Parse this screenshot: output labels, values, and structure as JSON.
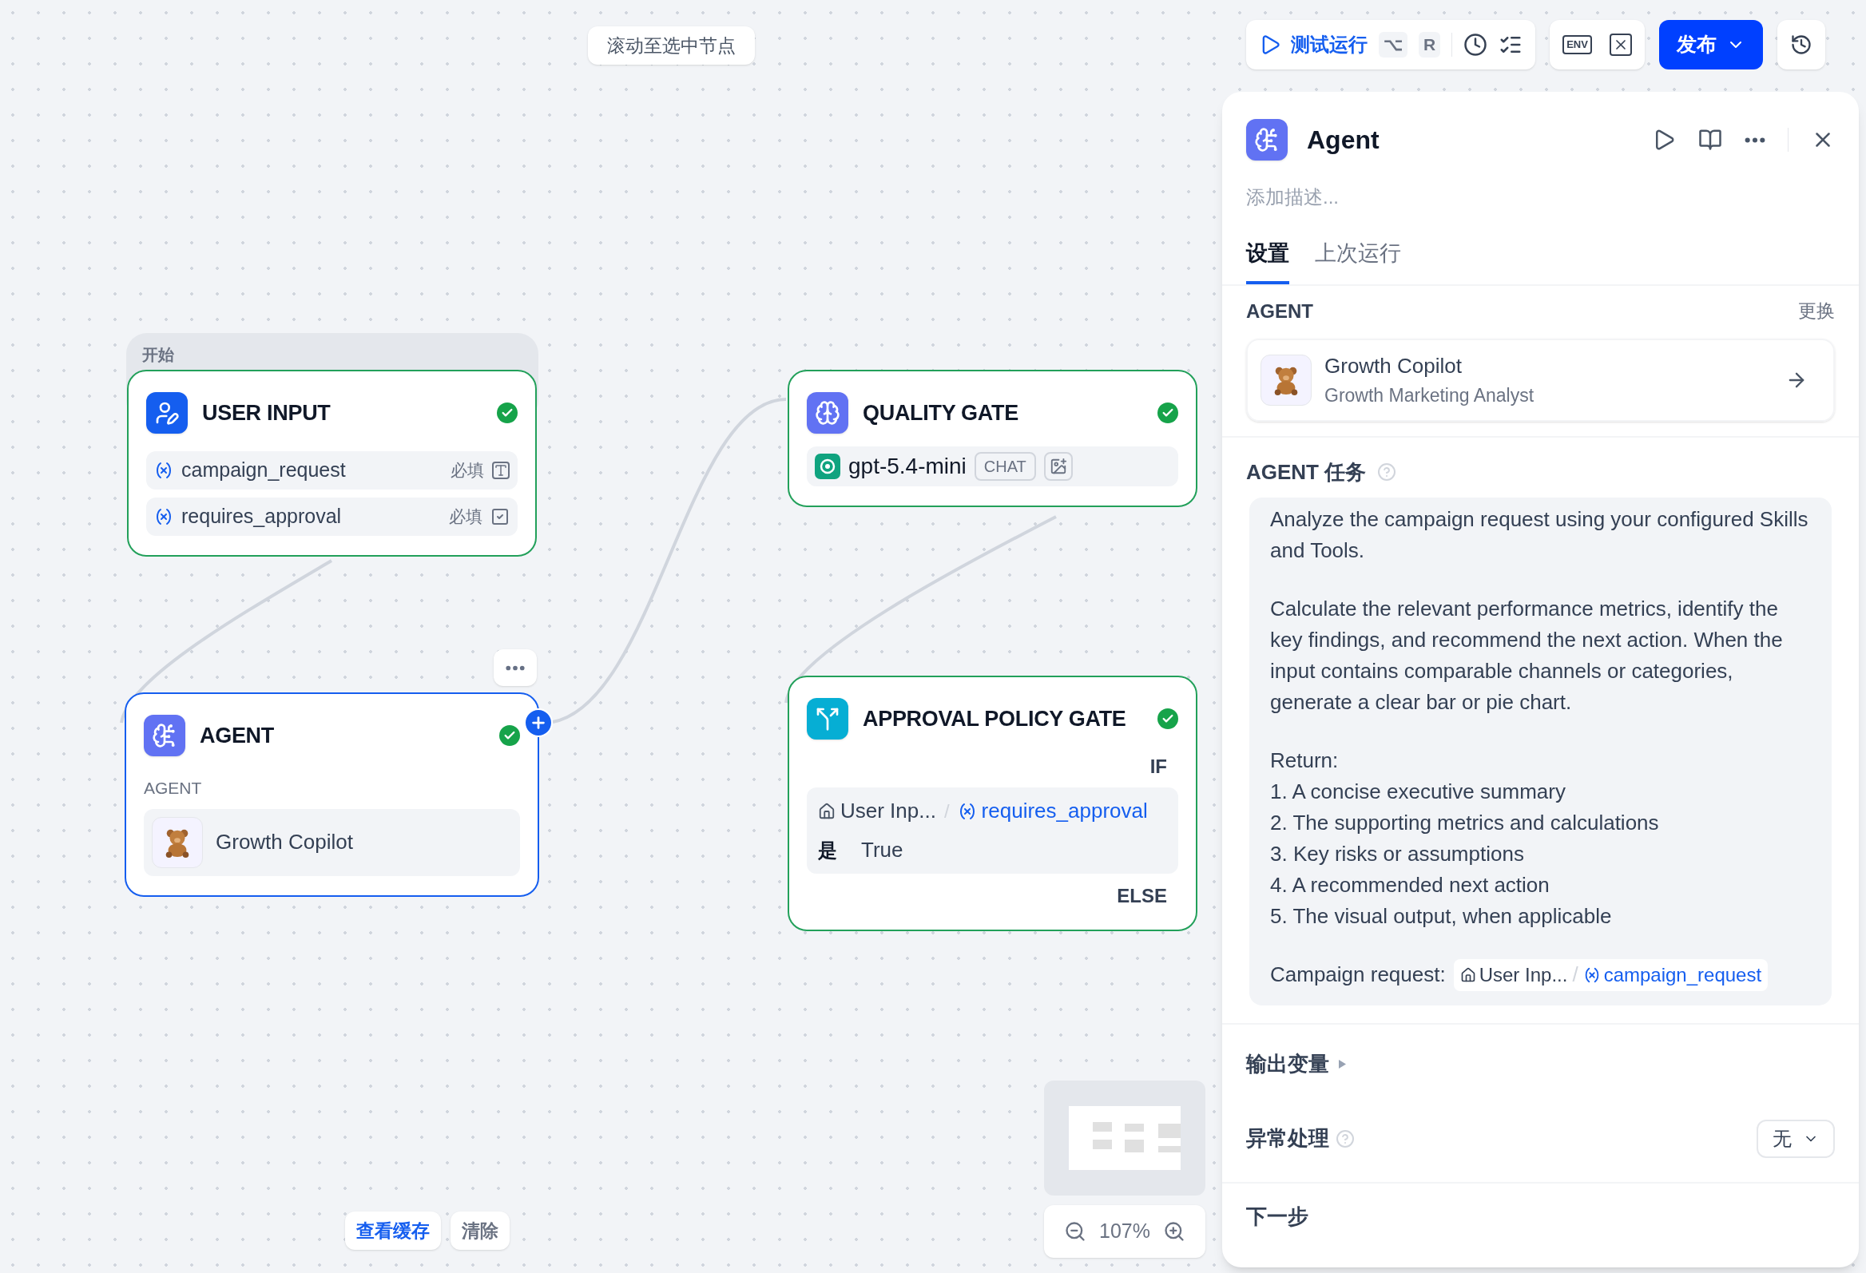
{
  "canvas": {
    "scroll_button": "滚动至选中节点",
    "nodes": [
      {
        "kind": "start",
        "group_label": "开始",
        "title": "USER INPUT",
        "succeeded": true,
        "selected": false,
        "variables": [
          {
            "name": "campaign_request",
            "required": "必填",
            "kind": "text"
          },
          {
            "name": "requires_approval",
            "required": "必填",
            "kind": "checkbox"
          }
        ]
      },
      {
        "kind": "agent",
        "title": "AGENT",
        "succeeded": true,
        "selected": true,
        "section_label": "AGENT",
        "agent_name": "Growth Copilot"
      },
      {
        "kind": "llm",
        "title": "QUALITY GATE",
        "succeeded": true,
        "selected": false,
        "model": "gpt-5.4-mini",
        "mode": "CHAT"
      },
      {
        "kind": "condition",
        "title": "APPROVAL POLICY GATE",
        "succeeded": true,
        "selected": false,
        "if_label": "IF",
        "condition": {
          "source": "User Inp...",
          "separator": "/",
          "variable": "requires_approval",
          "operator": "是",
          "value": "True"
        },
        "else_label": "ELSE"
      }
    ],
    "cache_buttons": [
      "查看缓存",
      "清除"
    ],
    "zoom": "107%"
  },
  "toolbar": {
    "test_run": "测试运行",
    "shortcut": [
      "⌥",
      "R"
    ],
    "env_label": "ENV",
    "publish": "发布"
  },
  "panel": {
    "title": "Agent",
    "description_placeholder": "添加描述...",
    "tabs": [
      {
        "label": "设置",
        "selected": true
      },
      {
        "label": "上次运行",
        "selected": false
      }
    ],
    "agent_section": {
      "label": "AGENT",
      "action": "更换",
      "name": "Growth Copilot",
      "role": "Growth Marketing Analyst"
    },
    "task_section": {
      "label": "AGENT 任务",
      "paragraphs": [
        "Analyze the campaign request using your configured Skills and Tools.",
        "Calculate the relevant performance metrics, identify the key findings, and recommend the next action. When the input contains comparable channels or categories, generate a clear bar or pie chart.",
        "Return:\n1. A concise executive summary\n2. The supporting metrics and calculations\n3. Key risks or assumptions\n4. A recommended next action\n5. The visual output, when applicable"
      ],
      "reference": {
        "prefix": "Campaign request:",
        "source": "User Inp...",
        "separator": "/",
        "variable": "campaign_request"
      }
    },
    "output_label": "输出变量",
    "error_label": "异常处理",
    "error_value": "无",
    "next_label": "下一步"
  }
}
